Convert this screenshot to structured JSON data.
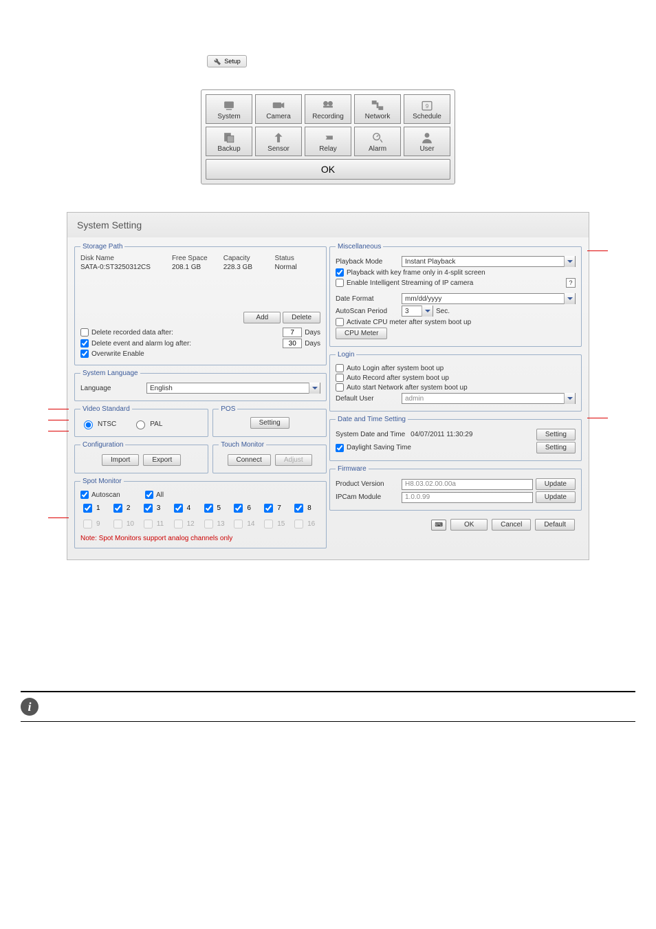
{
  "setup_button": {
    "label": "Setup"
  },
  "menu": {
    "items": [
      "System",
      "Camera",
      "Recording",
      "Network",
      "Schedule",
      "Backup",
      "Sensor",
      "Relay",
      "Alarm",
      "User"
    ],
    "ok": "OK"
  },
  "window": {
    "title": "System Setting",
    "storage": {
      "legend": "Storage Path",
      "headers": [
        "Disk Name",
        "Free Space",
        "Capacity",
        "Status"
      ],
      "row": [
        "SATA-0:ST3250312CS",
        "208.1 GB",
        "228.3 GB",
        "Normal"
      ],
      "add": "Add",
      "delete": "Delete",
      "del_recorded_label": "Delete recorded data after:",
      "del_recorded_days": "7",
      "days": "Days",
      "del_event_label": "Delete event and alarm log after:",
      "del_event_days": "30",
      "overwrite": "Overwrite Enable"
    },
    "language": {
      "legend": "System Language",
      "label": "Language",
      "value": "English"
    },
    "video": {
      "legend": "Video Standard",
      "ntsc": "NTSC",
      "pal": "PAL"
    },
    "pos": {
      "legend": "POS",
      "setting": "Setting"
    },
    "config": {
      "legend": "Configuration",
      "import": "Import",
      "export": "Export"
    },
    "touch": {
      "legend": "Touch Monitor",
      "connect": "Connect",
      "adjust": "Adjust"
    },
    "spot": {
      "legend": "Spot Monitor",
      "autoscan": "Autoscan",
      "all": "All",
      "active": [
        "1",
        "2",
        "3",
        "4",
        "5",
        "6",
        "7",
        "8"
      ],
      "inactive": [
        "9",
        "10",
        "11",
        "12",
        "13",
        "14",
        "15",
        "16"
      ],
      "note": "Note: Spot Monitors support analog channels only"
    },
    "misc": {
      "legend": "Miscellaneous",
      "playback_mode_label": "Playback Mode",
      "playback_mode_value": "Instant Playback",
      "keyframe": "Playback with key frame only in 4-split screen",
      "intelligent": "Enable Intelligent Streaming of IP camera",
      "help": "?",
      "date_format_label": "Date Format",
      "date_format_value": "mm/dd/yyyy",
      "autoscan_label": "AutoScan Period",
      "autoscan_value": "3",
      "sec": "Sec.",
      "cpu_activate": "Activate CPU meter after system boot up",
      "cpu_btn": "CPU Meter"
    },
    "login": {
      "legend": "Login",
      "auto_login": "Auto Login after system boot up",
      "auto_record": "Auto Record after system boot up",
      "auto_network": "Auto start Network after system boot up",
      "default_user_label": "Default User",
      "default_user_value": "admin"
    },
    "datetime": {
      "legend": "Date and Time Setting",
      "sdt_label": "System Date and Time",
      "sdt_value": "04/07/2011  11:30:29",
      "setting": "Setting",
      "dst": "Daylight Saving Time"
    },
    "firmware": {
      "legend": "Firmware",
      "product_label": "Product Version",
      "product_value": "H8.03.02.00.00a",
      "update": "Update",
      "ipcam_label": "IPCam Module",
      "ipcam_value": "1.0.0.99"
    },
    "buttons": {
      "ok": "OK",
      "cancel": "Cancel",
      "default": "Default"
    }
  }
}
